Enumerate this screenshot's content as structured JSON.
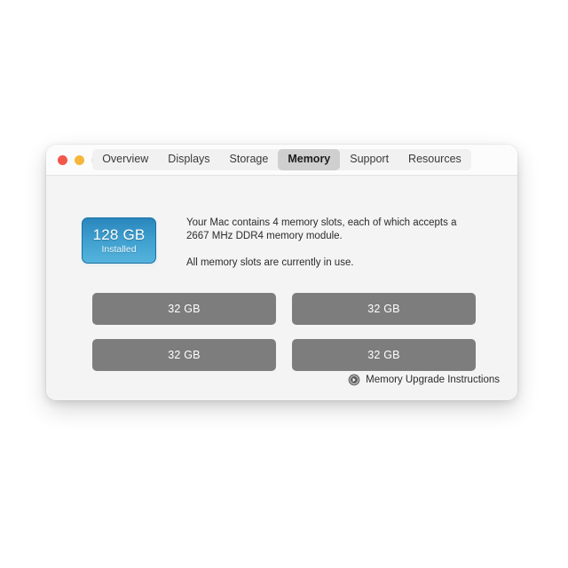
{
  "window": {
    "traffic_lights": [
      {
        "name": "close",
        "color": "#f3564a"
      },
      {
        "name": "minimize",
        "color": "#f6b63c"
      },
      {
        "name": "zoom",
        "color": "#dedede"
      }
    ],
    "tabs": [
      {
        "label": "Overview",
        "selected": false
      },
      {
        "label": "Displays",
        "selected": false
      },
      {
        "label": "Storage",
        "selected": false
      },
      {
        "label": "Memory",
        "selected": true
      },
      {
        "label": "Support",
        "selected": false
      },
      {
        "label": "Resources",
        "selected": false
      }
    ]
  },
  "badge": {
    "size": "128 GB",
    "status": "Installed",
    "accent_color": "#3d9dcd"
  },
  "description": {
    "paragraph_1": "Your Mac contains 4 memory slots, each of which accepts a 2667 MHz DDR4 memory module.",
    "paragraph_2": "All memory slots are currently in use."
  },
  "slots": [
    {
      "label": "32 GB"
    },
    {
      "label": "32 GB"
    },
    {
      "label": "32 GB"
    },
    {
      "label": "32 GB"
    }
  ],
  "footer": {
    "link_label": "Memory Upgrade Instructions",
    "icon": "circle-arrow-right-icon"
  }
}
